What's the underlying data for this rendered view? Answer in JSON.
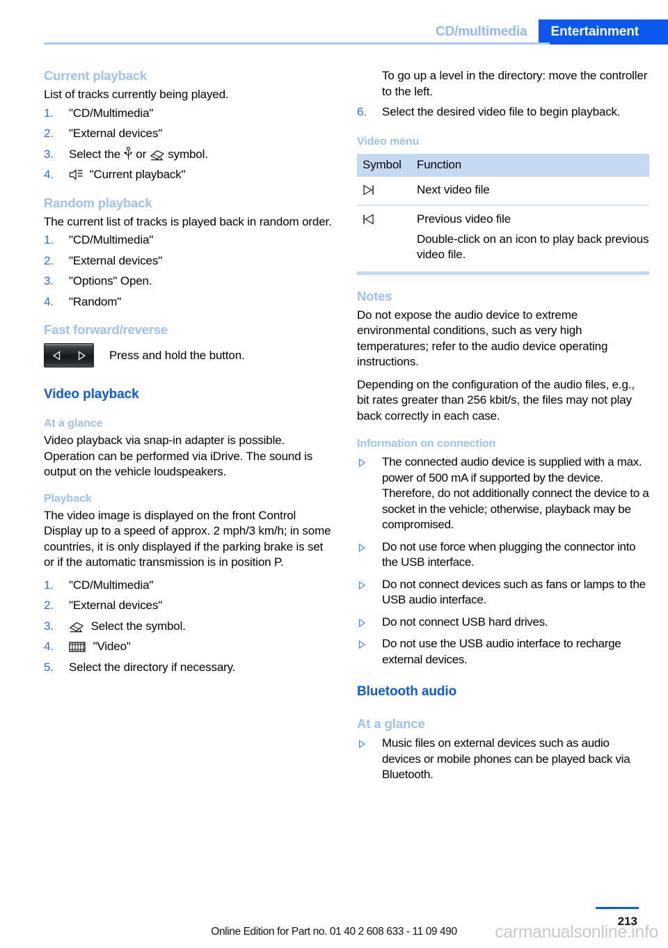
{
  "header": {
    "tab_inactive": "CD/multimedia",
    "tab_active": "Entertainment",
    "accent_blue": "#0a58f0",
    "light_blue": "#9dc2ef"
  },
  "left": {
    "current_playback": {
      "heading": "Current playback",
      "intro": "List of tracks currently being played.",
      "steps": [
        {
          "num": "1.",
          "text": "\"CD/Multimedia\""
        },
        {
          "num": "2.",
          "text": "\"External devices\""
        },
        {
          "num": "3.",
          "text_before": "Select the",
          "icon1": "usb-icon",
          "text_mid": "or",
          "icon2": "snap-in-adapter-icon",
          "text_after": "symbol."
        },
        {
          "num": "4.",
          "icon": "current-playback-icon",
          "text": "\"Current playback\""
        }
      ]
    },
    "random_playback": {
      "heading": "Random playback",
      "intro": "The current list of tracks is played back in random order.",
      "steps": [
        {
          "num": "1.",
          "text": "\"CD/Multimedia\""
        },
        {
          "num": "2.",
          "text": "\"External devices\""
        },
        {
          "num": "3.",
          "text": "\"Options\" Open."
        },
        {
          "num": "4.",
          "text": "\"Random\""
        }
      ]
    },
    "fast_forward": {
      "heading": "Fast forward/reverse",
      "button_icon": "fast-forward-reverse-button",
      "label": "Press and hold the button."
    },
    "video_playback": {
      "heading": "Video playback",
      "at_a_glance": {
        "heading": "At a glance",
        "text": "Video playback via snap-in adapter is possible. Operation can be performed via iDrive. The sound is output on the vehicle loudspeakers."
      },
      "playback": {
        "heading": "Playback",
        "text": "The video image is displayed on the front Control Display up to a speed of approx. 2 mph/3 km/h; in some countries, it is only displayed if the parking brake is set or if the automatic transmission is in position P.",
        "steps": [
          {
            "num": "1.",
            "text": "\"CD/Multimedia\""
          },
          {
            "num": "2.",
            "text": "\"External devices\""
          },
          {
            "num": "3.",
            "icon": "snap-in-adapter-icon",
            "text": "Select the symbol."
          },
          {
            "num": "4.",
            "icon": "film-strip-icon",
            "text": "\"Video\""
          },
          {
            "num": "5.",
            "text": "Select the directory if necessary."
          }
        ]
      }
    }
  },
  "right": {
    "continued_steps": {
      "continuation": "To go up a level in the directory: move the controller to the left.",
      "step6": {
        "num": "6.",
        "text": "Select the desired video file to begin playback."
      }
    },
    "video_menu": {
      "heading": "Video menu",
      "columns": [
        "Symbol",
        "Function"
      ],
      "rows": [
        {
          "symbol": "next-video-icon",
          "function": "Next video file",
          "note": ""
        },
        {
          "symbol": "previous-video-icon",
          "function": "Previous video file",
          "note": "Double-click on an icon to play back previous video file."
        }
      ]
    },
    "notes": {
      "heading": "Notes",
      "paragraphs": [
        "Do not expose the audio device to extreme environmental conditions, such as very high temperatures; refer to the audio device operating instructions.",
        "Depending on the configuration of the audio files, e.g., bit rates greater than 256 kbit/s, the files may not play back correctly in each case."
      ]
    },
    "information_on_connection": {
      "heading": "Information on connection",
      "bullets": [
        "The connected audio device is supplied with a max. power of 500 mA if supported by the device. Therefore, do not additionally connect the device to a socket in the vehicle; otherwise, playback may be compromised.",
        "Do not use force when plugging the connector into the USB interface.",
        "Do not connect devices such as fans or lamps to the USB audio interface.",
        "Do not connect USB hard drives.",
        "Do not use the USB audio interface to recharge external devices."
      ]
    },
    "bluetooth_audio": {
      "heading": "Bluetooth audio",
      "at_a_glance": {
        "heading": "At a glance",
        "bullets": [
          "Music files on external devices such as audio devices or mobile phones can be played back via Bluetooth."
        ]
      }
    }
  },
  "footer": {
    "edition_text": "Online Edition for Part no. 01 40 2 608 633 - 11 09 490",
    "page_number": "213",
    "watermark": "carmanualsonline.info"
  }
}
